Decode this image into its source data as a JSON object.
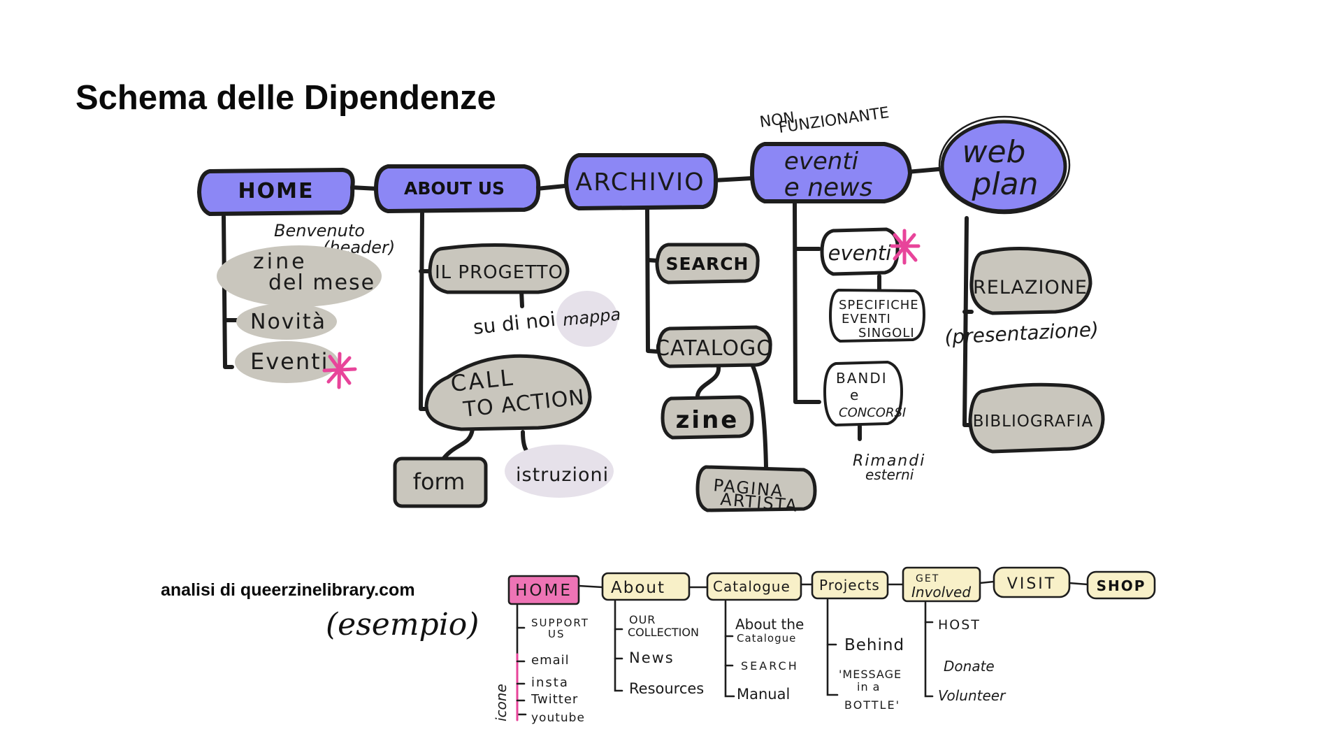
{
  "title": "Schema delle Dipendenze",
  "colors": {
    "primary": "#8c87f5",
    "secondary": "#c9c6bd",
    "tertiary": "#e6e1ea",
    "accent": "#e8449a",
    "ref_yellow": "#f8f0c8",
    "ref_pink": "#ee74b5"
  },
  "primary_nodes": {
    "home": "HOME",
    "about": "ABOUT US",
    "archivio": "ARCHIVIO",
    "eventi_news": [
      "eventi",
      "e news"
    ],
    "web_plan": [
      "web",
      "plan"
    ]
  },
  "annotations": {
    "non_funzionante": [
      "NON",
      "FUNZIONANTE"
    ],
    "benvenuto": [
      "Benvenuto",
      "(header)"
    ],
    "su_di_noi": "su di noi /",
    "mappa": "mappa",
    "istruzioni": "istruzioni",
    "rimandi": [
      "Rimandi",
      "esterni"
    ],
    "presentazione": "(presentazione)"
  },
  "home_children": {
    "zine_del_mese": [
      "zine",
      "del mese"
    ],
    "novita": "Novità",
    "eventi": "Eventi"
  },
  "about_children": {
    "il_progetto": "IL PROGETTO",
    "call_to_action": [
      "CALL",
      "TO ACTION"
    ],
    "form": "form"
  },
  "archivio_children": {
    "search": "SEARCH",
    "catalogo": "CATALOGO",
    "zine": "zine",
    "pagina_artista": [
      "PAGINA",
      "ARTISTA"
    ]
  },
  "eventi_children": {
    "eventi": "eventi",
    "specifiche": [
      "SPECIFICHE",
      "EVENTI",
      "SINGOLI"
    ],
    "bandi": [
      "BANDI",
      "e",
      "CONCORSI"
    ]
  },
  "webplan_children": {
    "relazione": "RELAZIONE",
    "bibliografia": "BIBLIOGRAFIA"
  },
  "analysis_label": "analisi di queerzinelibrary.com",
  "example_label": "(esempio)",
  "reference_nav": {
    "home": "HOME",
    "about": "About",
    "catalogue": "Catalogue",
    "projects": "Projects",
    "get_involved": [
      "GET",
      "Involved"
    ],
    "visit": "VISIT",
    "shop": "SHOP",
    "icone": "icone",
    "home_items": [
      [
        "SUPPORT",
        "US"
      ],
      "email",
      "insta",
      "Twitter",
      "youtube"
    ],
    "about_items": [
      [
        "OUR",
        "COLLECTION"
      ],
      "News",
      "Resources"
    ],
    "catalogue_items": [
      [
        "About the",
        "Catalogue"
      ],
      "SEARCH",
      "Manual"
    ],
    "projects_items": [
      "Behind",
      [
        "'MESSAGE",
        "in a",
        "BOTTLE'"
      ]
    ],
    "get_involved_items": [
      "HOST",
      "Donate",
      "Volunteer"
    ]
  }
}
